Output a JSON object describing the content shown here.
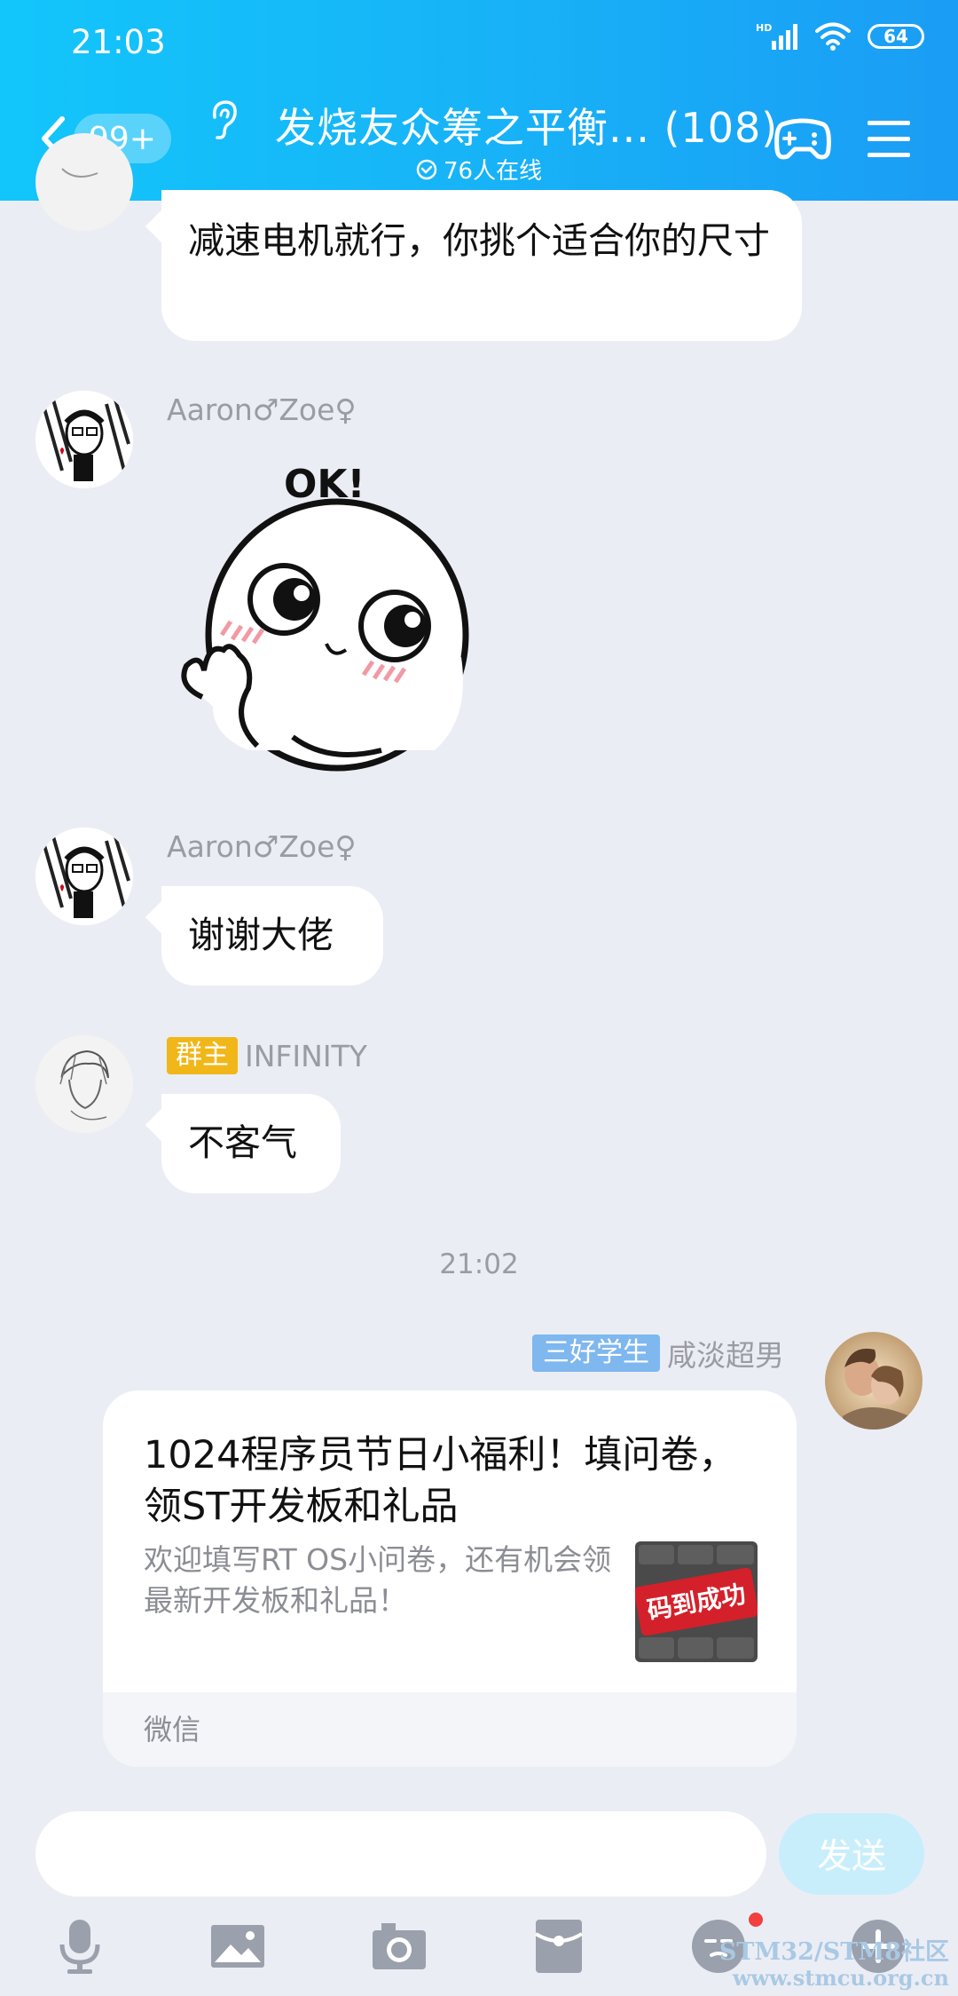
{
  "status_bar": {
    "time": "21:03",
    "battery": "64",
    "signal_label": "HD"
  },
  "header": {
    "unread_count": "99+",
    "group_title": "发烧友众筹之平衡... (108)",
    "online_count": "76人在线"
  },
  "messages": [
    {
      "text": "减速电机就行，你挑个适合你的尺寸"
    },
    {
      "sender": "Aaron♂Zoe♀",
      "sticker_text": "OK!"
    },
    {
      "sender": "Aaron♂Zoe♀",
      "text": "谢谢大佬"
    },
    {
      "sender": "INFINITY",
      "badge": "群主",
      "text": "不客气"
    }
  ],
  "timestamp": "21:02",
  "own_message": {
    "badge": "三好学生",
    "sender": "咸淡超男",
    "card": {
      "title": "1024程序员节日小福利！填问卷，领ST开发板和礼品",
      "description": "欢迎填写RT OS小问卷，还有机会领最新开发板和礼品！",
      "thumb_text": "码到成功",
      "source": "微信"
    }
  },
  "input": {
    "placeholder": "",
    "send_label": "发送"
  },
  "watermark": {
    "line1": "STM32/STM8社区",
    "line2": "www.stmcu.org.cn"
  },
  "colors": {
    "header_start": "#12c6fb",
    "header_end": "#1a9df5",
    "chat_bg": "#ebedf5",
    "owner_badge": "#f1b719",
    "title_badge": "#7fb7ef"
  }
}
